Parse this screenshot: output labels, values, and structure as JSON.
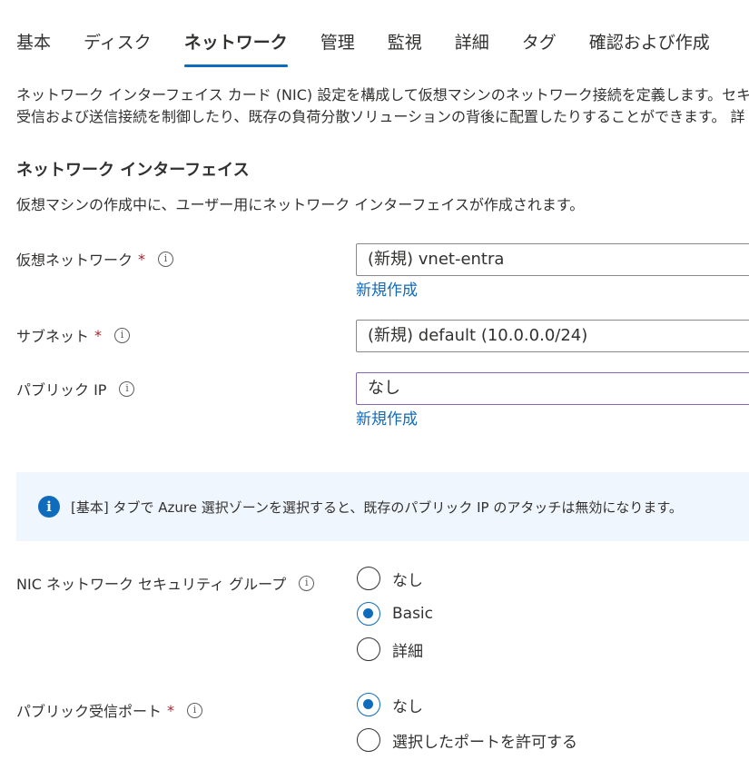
{
  "tabs": [
    {
      "label": "基本",
      "active": false
    },
    {
      "label": "ディスク",
      "active": false
    },
    {
      "label": "ネットワーク",
      "active": true
    },
    {
      "label": "管理",
      "active": false
    },
    {
      "label": "監視",
      "active": false
    },
    {
      "label": "詳細",
      "active": false
    },
    {
      "label": "タグ",
      "active": false
    },
    {
      "label": "確認および作成",
      "active": false
    }
  ],
  "description": {
    "line1": "ネットワーク インターフェイス カード (NIC) 設定を構成して仮想マシンのネットワーク接続を定義します。セキ",
    "line2": "受信および送信接続を制御したり、既存の負荷分散ソリューションの背後に配置したりすることができます。 詳"
  },
  "network_interface": {
    "title": "ネットワーク インターフェイス",
    "description": "仮想マシンの作成中に、ユーザー用にネットワーク インターフェイスが作成されます。"
  },
  "fields": {
    "vnet": {
      "label": "仮想ネットワーク",
      "required_mark": "*",
      "value": "(新規) vnet-entra",
      "link": "新規作成"
    },
    "subnet": {
      "label": "サブネット",
      "required_mark": "*",
      "value": "(新規) default (10.0.0.0/24)"
    },
    "public_ip": {
      "label": "パブリック IP",
      "value": "なし",
      "link": "新規作成"
    }
  },
  "info_banner": {
    "icon": "i",
    "text": "[基本] タブで Azure 選択ゾーンを選択すると、既存のパブリック IP のアタッチは無効になります。"
  },
  "nic_nsg": {
    "label": "NIC ネットワーク セキュリティ グループ",
    "options": [
      "なし",
      "Basic",
      "詳細"
    ],
    "selected": "Basic"
  },
  "inbound_ports": {
    "label": "パブリック受信ポート",
    "required_mark": "*",
    "options": [
      "なし",
      "選択したポートを許可する"
    ],
    "selected": "なし"
  },
  "info_icon_glyph": "i",
  "colors": {
    "accent": "#0f6cbd",
    "required": "#a4262c",
    "info_bg": "#f0f6fd",
    "focus_border": "#8764b8"
  }
}
